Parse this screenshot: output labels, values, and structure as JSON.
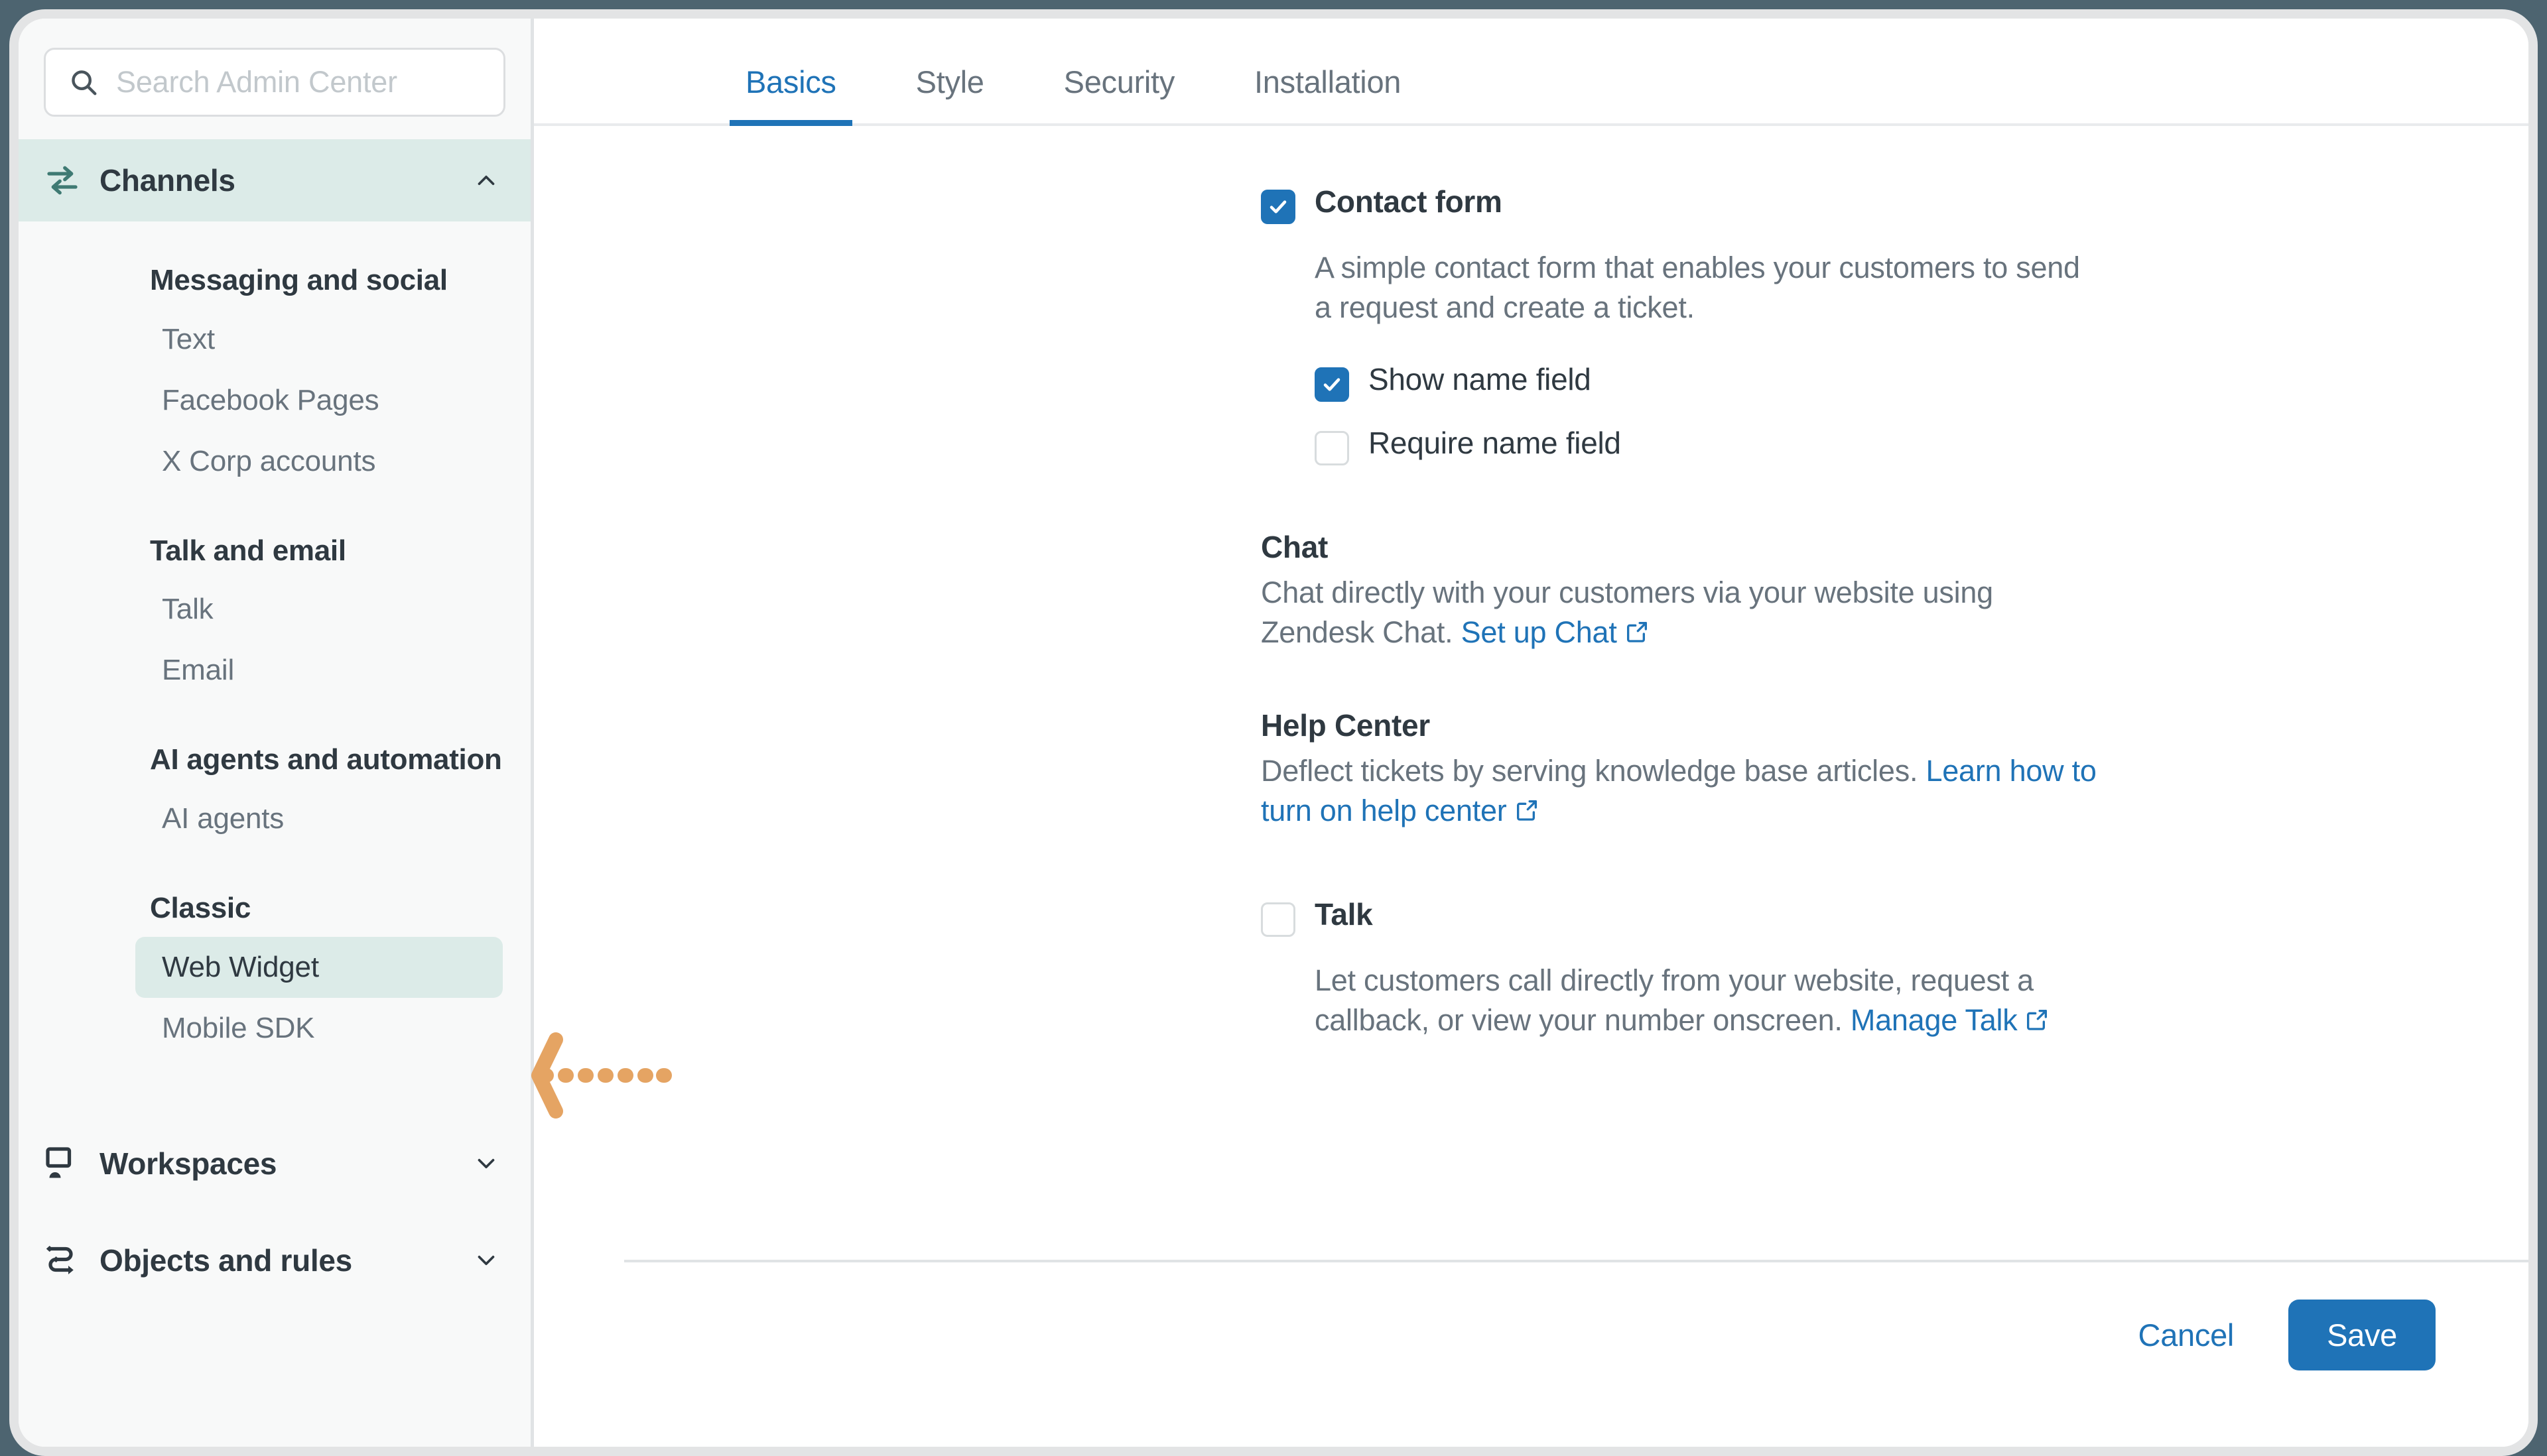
{
  "colors": {
    "accent_blue": "#1f73b7",
    "teal_highlight": "#dcebe8",
    "teal_icon": "#3f7a73",
    "text_dark": "#2f3941",
    "text_muted": "#68737d",
    "annotation_orange": "#e7a köp"
  },
  "search": {
    "placeholder": "Search Admin Center",
    "value": "",
    "icon": "search-icon"
  },
  "sidebar": {
    "groups": [
      {
        "label": "Channels",
        "icon": "channels-transfer-icon",
        "chevron": "chevron-up-icon",
        "active": true
      },
      {
        "label": "Workspaces",
        "icon": "workspaces-monitor-icon",
        "chevron": "chevron-down-icon",
        "active": false
      },
      {
        "label": "Objects and rules",
        "icon": "objects-rules-flow-icon",
        "chevron": "chevron-down-icon",
        "active": false
      }
    ],
    "sections": [
      {
        "heading": "Messaging and social",
        "items": [
          {
            "label": "Text",
            "selected": false
          },
          {
            "label": "Facebook Pages",
            "selected": false
          },
          {
            "label": "X Corp accounts",
            "selected": false
          }
        ]
      },
      {
        "heading": "Talk and email",
        "items": [
          {
            "label": "Talk",
            "selected": false
          },
          {
            "label": "Email",
            "selected": false
          }
        ]
      },
      {
        "heading": "AI agents and automation",
        "items": [
          {
            "label": "AI agents",
            "selected": false
          }
        ]
      },
      {
        "heading": "Classic",
        "items": [
          {
            "label": "Web Widget",
            "selected": true
          },
          {
            "label": "Mobile SDK",
            "selected": false
          }
        ]
      }
    ]
  },
  "main": {
    "tabs": [
      {
        "label": "Basics",
        "active": true
      },
      {
        "label": "Style",
        "active": false
      },
      {
        "label": "Security",
        "active": false
      },
      {
        "label": "Installation",
        "active": false
      }
    ],
    "contact_form": {
      "label": "Contact form",
      "checked": true,
      "description": "A simple contact form that enables your customers to send a request and create a ticket.",
      "options": [
        {
          "label": "Show name field",
          "checked": true
        },
        {
          "label": "Require name field",
          "checked": false
        }
      ]
    },
    "chat": {
      "title": "Chat",
      "description_before": "Chat directly with your customers via your website using Zendesk Chat.",
      "link_label": "Set up Chat",
      "link_icon": "external-link-icon"
    },
    "help_center": {
      "title": "Help Center",
      "description_before": "Deflect tickets by serving knowledge base articles.",
      "link_label": "Learn how to turn on help center",
      "link_icon": "external-link-icon"
    },
    "talk": {
      "label": "Talk",
      "checked": false,
      "description_before": "Let customers call directly from your website, request a callback, or view your number onscreen.",
      "link_label": "Manage Talk",
      "link_icon": "external-link-icon"
    }
  },
  "footer": {
    "cancel_label": "Cancel",
    "save_label": "Save"
  },
  "annotation": {
    "type": "dashed-arrow-left",
    "color": "#e9a köp",
    "points_to": "Web Widget"
  }
}
